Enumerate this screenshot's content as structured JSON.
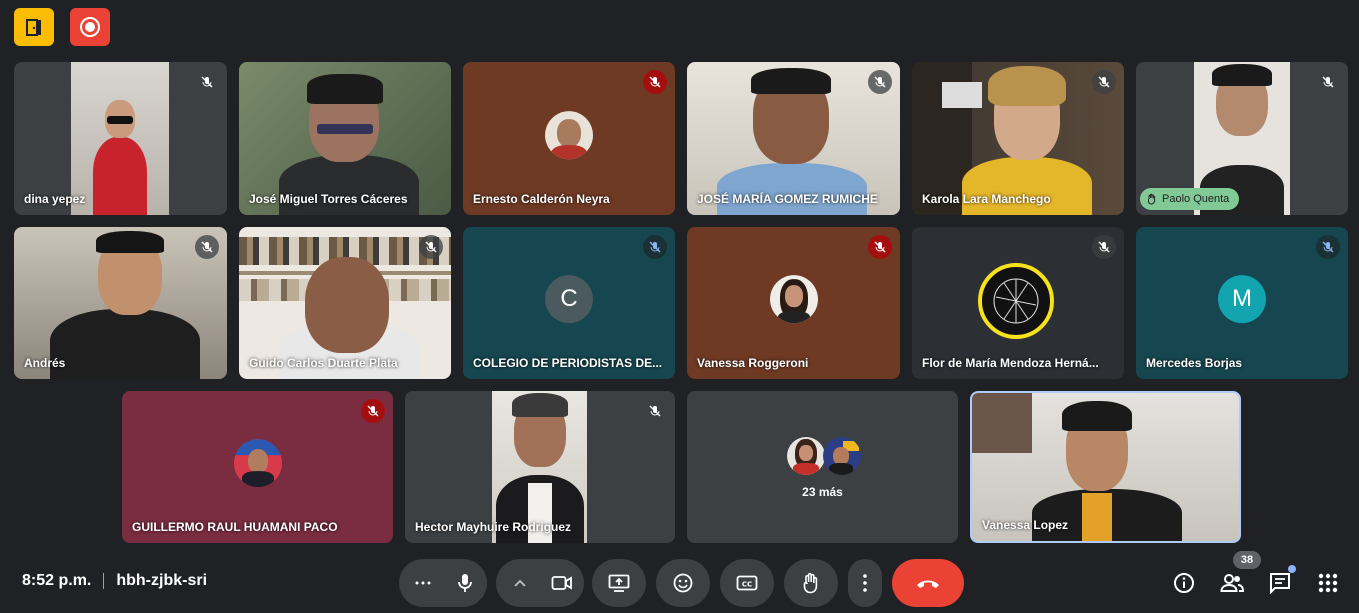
{
  "meeting": {
    "time": "8:52 p.m.",
    "code": "hbh-zjbk-sri",
    "participant_count": "38"
  },
  "colors": {
    "background": "#202124",
    "end_call": "#ea4335",
    "mic_muted_red": "#a50e0e",
    "activity_pill": "#81c995",
    "top_badge_yellow": "#fbbc04",
    "top_badge_red": "#ea4335"
  },
  "tiles": [
    {
      "name": "dina yepez",
      "mic": "muted"
    },
    {
      "name": "José Miguel Torres Cáceres",
      "mic": "none"
    },
    {
      "name": "Ernesto Calderón Neyra",
      "mic": "muted"
    },
    {
      "name": "JOSÉ MARÍA GOMEZ RUMICHE",
      "mic": "muted"
    },
    {
      "name": "Karola Lara Manchego",
      "mic": "muted"
    },
    {
      "name": "Paolo Quenta",
      "mic": "muted",
      "hand_raised": true
    },
    {
      "name": "Andrés",
      "mic": "muted"
    },
    {
      "name": "Guido Carlos Duarte Plata",
      "mic": "muted"
    },
    {
      "name": "COLEGIO DE PERIODISTAS DE...",
      "mic": "muted",
      "avatar_letter": "C"
    },
    {
      "name": "Vanessa Roggeroni",
      "mic": "muted"
    },
    {
      "name": "Flor de María Mendoza Herná...",
      "mic": "muted"
    },
    {
      "name": "Mercedes Borjas",
      "mic": "muted",
      "avatar_letter": "M"
    },
    {
      "name": "GUILLERMO RAUL HUAMANI PACO",
      "mic": "muted"
    },
    {
      "name": "Hector Mayhuire Rodriguez",
      "mic": "muted"
    },
    {
      "name": "",
      "more_label": "23 más"
    },
    {
      "name": "Vanessa Lopez",
      "active_speaker": true
    }
  ],
  "icons": {
    "top_left_1": "doorway-icon",
    "top_left_2": "record-icon",
    "controls": [
      "more-options-icon",
      "mic-icon",
      "chevron-up-icon",
      "camera-icon",
      "present-icon",
      "emoji-icon",
      "captions-icon",
      "hand-icon",
      "more-vert-icon",
      "end-call-icon"
    ],
    "right": [
      "info-icon",
      "people-icon",
      "chat-icon",
      "activities-icon"
    ]
  }
}
